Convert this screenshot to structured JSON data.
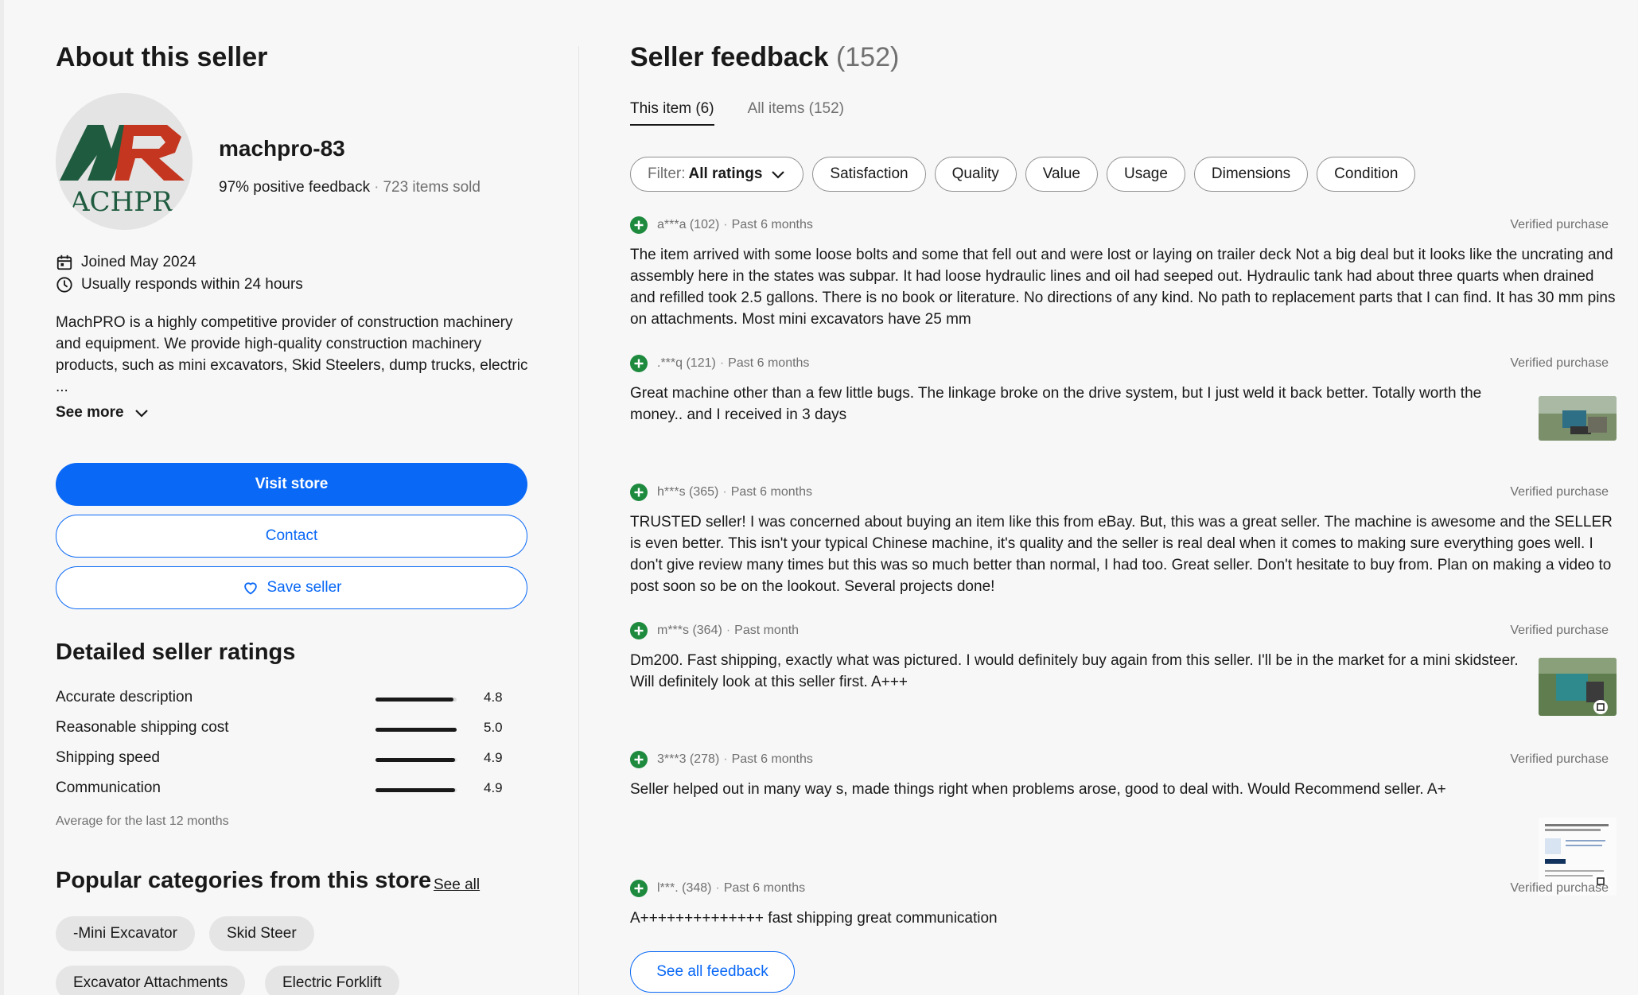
{
  "about": {
    "heading": "About this seller",
    "logo_text": "ACHPR",
    "seller_name": "machpro-83",
    "positive_feedback": "97% positive feedback",
    "items_sold": "723 items sold",
    "joined": "Joined May 2024",
    "responds": "Usually responds within 24 hours",
    "description": "MachPRO is a highly competitive provider of construction machinery and equipment. We provide high-quality construction machinery products, such as mini excavators, Skid Steelers, dump trucks, electric ...",
    "see_more": "See more",
    "visit_store": "Visit store",
    "contact": "Contact",
    "save_seller": "Save seller"
  },
  "ratings": {
    "heading": "Detailed seller ratings",
    "items": [
      {
        "label": "Accurate description",
        "value": "4.8"
      },
      {
        "label": "Reasonable shipping cost",
        "value": "5.0"
      },
      {
        "label": "Shipping speed",
        "value": "4.9"
      },
      {
        "label": "Communication",
        "value": "4.9"
      }
    ],
    "note": "Average for the last 12 months"
  },
  "popular": {
    "heading": "Popular categories from this store",
    "see_all": "See all",
    "categories": [
      "-Mini Excavator",
      "Skid Steer",
      "Excavator Attachments",
      "Electric Forklift"
    ]
  },
  "feedback": {
    "heading": "Seller feedback",
    "count": "(152)",
    "tabs": [
      "This item (6)",
      "All items (152)"
    ],
    "filter_label": "Filter:",
    "filter_value": "All ratings",
    "filter_chips": [
      "Satisfaction",
      "Quality",
      "Value",
      "Usage",
      "Dimensions",
      "Condition"
    ],
    "verified_label": "Verified purchase",
    "reviews": [
      {
        "user": "a***a (102)",
        "time": "Past 6 months",
        "text": "The item arrived with some loose bolts and some that fell out and were lost or laying on trailer deck Not a big deal but it looks like the uncrating and assembly here in the states was subpar. It had loose hydraulic lines and oil had seeped out. Hydraulic tank had about three quarts when drained and refilled took 2.5 gallons. There is no book or literature. No directions of any kind. No path to replacement parts that I can find. It has 30 mm pins on attachments. Most mini excavators have 25 mm"
      },
      {
        "user": ".***q (121)",
        "time": "Past 6 months",
        "text": "Great machine other than a few little bugs. The linkage broke on the drive system, but I just weld it back better. Totally worth the money.. and I received in 3 days"
      },
      {
        "user": "h***s (365)",
        "time": "Past 6 months",
        "text": "TRUSTED seller! I was concerned about buying an item like this from eBay. But, this was a great seller. The machine is awesome and the SELLER is even better. This isn't your typical Chinese machine, it's quality and the seller is real deal when it comes to making sure everything goes well. I don't give review many times but this was so much better than normal, I had too. Great seller. Don't hesitate to buy from. Plan on making a video to post soon so be on the lookout. Several projects done!"
      },
      {
        "user": "m***s (364)",
        "time": "Past month",
        "text": "Dm200. Fast shipping, exactly what was pictured. I would definitely buy again from this seller. I'll be in the market for a mini skidsteer. Will definitely look at this seller first. A+++"
      },
      {
        "user": "3***3 (278)",
        "time": "Past 6 months",
        "text": "Seller helped out in many way s, made things right when problems arose, good to deal with. Would Recommend seller. A+"
      },
      {
        "user": "l***. (348)",
        "time": "Past 6 months",
        "text": "A++++++++++++++ fast shipping great communication"
      }
    ],
    "see_all_feedback": "See all feedback"
  },
  "colors": {
    "accent": "#0968f6",
    "positive": "#1e8a3e",
    "logo_green": "#1f5b3f",
    "logo_red": "#c4361f"
  }
}
